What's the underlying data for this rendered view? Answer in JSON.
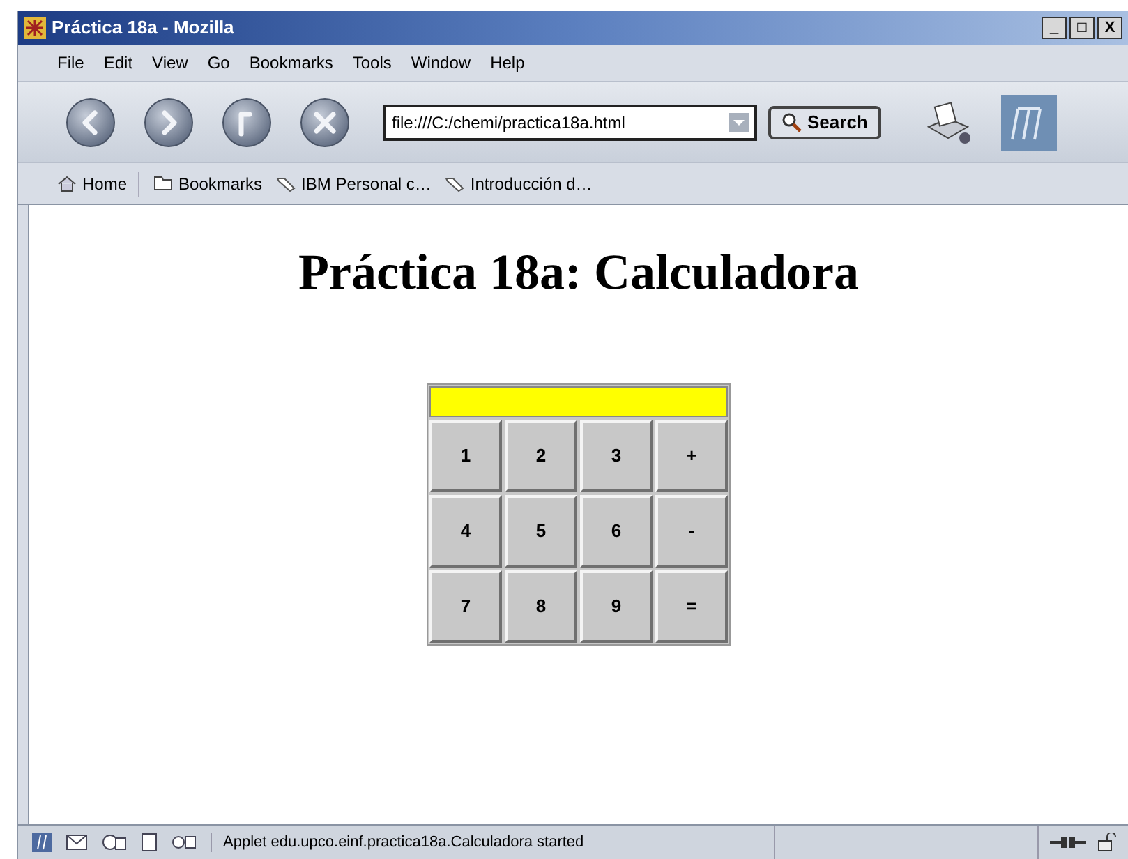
{
  "window": {
    "title": "Práctica 18a - Mozilla",
    "controls": [
      "_",
      "□",
      "X"
    ]
  },
  "menu": [
    "File",
    "Edit",
    "View",
    "Go",
    "Bookmarks",
    "Tools",
    "Window",
    "Help"
  ],
  "navigation": {
    "url": "file:///C:/chemi/practica18a.html",
    "search": "Search"
  },
  "personal_bar": [
    {
      "label": "Home",
      "kind": "home"
    },
    {
      "label": "Bookmarks",
      "kind": "folder"
    },
    {
      "label": "IBM Personal c…",
      "kind": "link"
    },
    {
      "label": "Introducción d…",
      "kind": "link"
    }
  ],
  "page": {
    "heading": "Práctica 18a: Calculadora",
    "calculator": {
      "keys": [
        "1",
        "2",
        "3",
        "+",
        "4",
        "5",
        "6",
        "-",
        "7",
        "8",
        "9",
        "="
      ]
    }
  },
  "status_bar": {
    "message": "Applet edu.upco.einf.practica18a.Calculadora started"
  }
}
